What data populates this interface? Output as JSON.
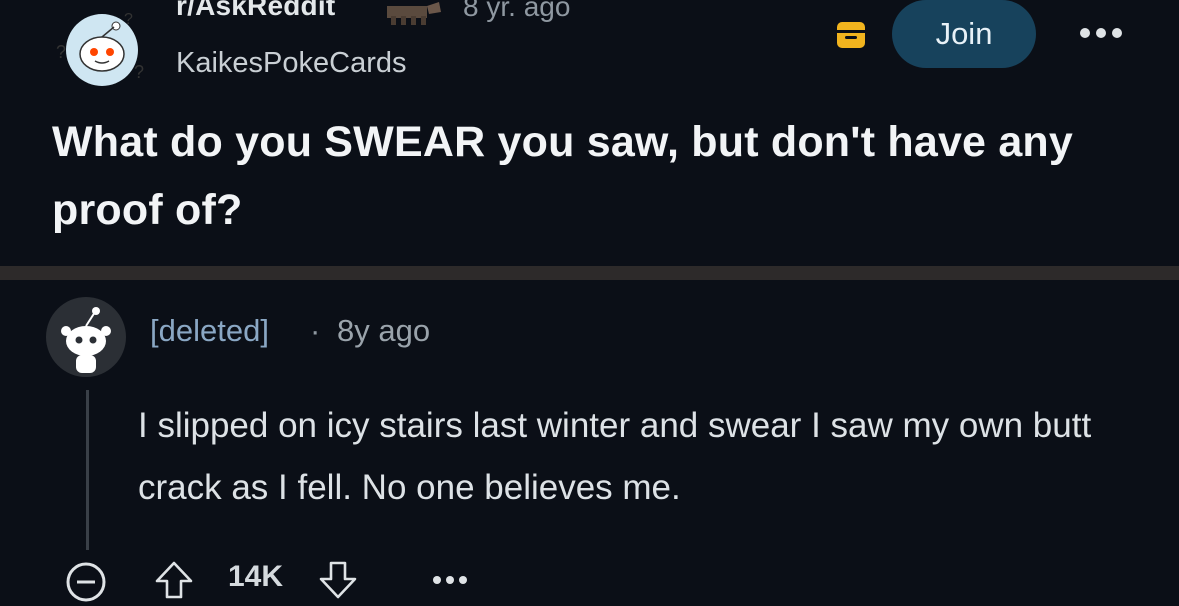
{
  "post": {
    "subreddit": "r/AskReddit",
    "age": "8 yr. ago",
    "author": "KaikesPokeCards",
    "join_label": "Join",
    "title": "What do you SWEAR you saw, but don't have any proof of?",
    "icons": {
      "subreddit_avatar": "askreddit-snoo-icon",
      "award": "award-icon",
      "save": "save-icon",
      "more": "more-options-icon"
    }
  },
  "comment": {
    "user": "[deleted]",
    "separator": "·",
    "age": "8y ago",
    "body": "I slipped on icy stairs last winter and swear I saw my own butt crack as I fell. No one believes me.",
    "score": "14K",
    "icons": {
      "avatar": "snoo-avatar-icon",
      "collapse": "collapse-icon",
      "upvote": "upvote-icon",
      "downvote": "downvote-icon",
      "more": "more-options-icon"
    }
  },
  "colors": {
    "background": "#0b0f17",
    "join_button": "#17425c",
    "divider": "#2d2a2a",
    "username": "#8aa7c4",
    "save_icon": "#f2b41e"
  }
}
